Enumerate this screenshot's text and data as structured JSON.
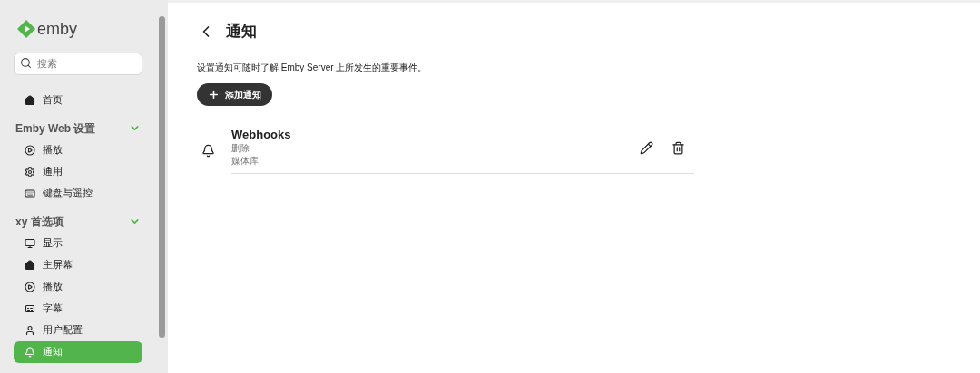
{
  "sidebar": {
    "logo": "emby",
    "search": {
      "placeholder": "搜索"
    },
    "home": {
      "label": "首页",
      "kind": "home",
      "selected": false
    },
    "sections": [
      {
        "title": "Emby Web 设置",
        "expanded": true,
        "items": [
          {
            "label": "播放",
            "kind": "play",
            "selected": false
          },
          {
            "label": "通用",
            "kind": "cog",
            "selected": false
          },
          {
            "label": "键盘与遥控",
            "kind": "keyboard",
            "selected": false
          }
        ]
      },
      {
        "title": "xy 首选项",
        "expanded": true,
        "items": [
          {
            "label": "显示",
            "kind": "monitor",
            "selected": false
          },
          {
            "label": "主屏幕",
            "kind": "home",
            "selected": false
          },
          {
            "label": "播放",
            "kind": "play",
            "selected": false
          },
          {
            "label": "字幕",
            "kind": "captions",
            "selected": false
          },
          {
            "label": "用户配置",
            "kind": "user",
            "selected": false
          },
          {
            "label": "通知",
            "kind": "bell",
            "selected": true
          }
        ]
      }
    ]
  },
  "page": {
    "title": "通知",
    "description": "设置通知可随时了解 Emby Server 上所发生的重要事件。",
    "add_button": "添加通知",
    "notifications": [
      {
        "name": "Webhooks",
        "lines": [
          "删除",
          "媒体库"
        ]
      }
    ]
  }
}
